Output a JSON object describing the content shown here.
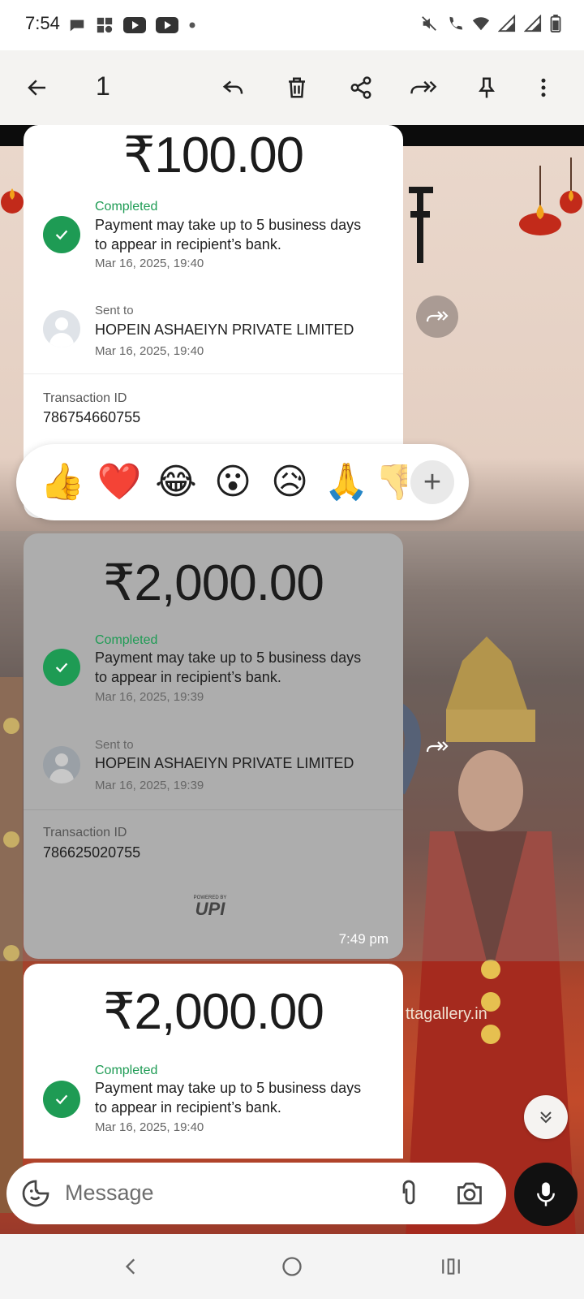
{
  "status_bar": {
    "time": "7:54",
    "left_icons": [
      "chat-bubble-icon",
      "photos-icon",
      "youtube-icon",
      "youtube-icon",
      "dot-icon"
    ],
    "right_icons": [
      "mute-icon",
      "wifi-calling-icon",
      "wifi-icon",
      "signal-icon",
      "signal-icon",
      "battery-icon"
    ]
  },
  "toolbar": {
    "selected_count": "1",
    "actions": [
      "back",
      "reply",
      "delete",
      "share",
      "forward",
      "pin",
      "more"
    ]
  },
  "reactions": {
    "emojis": [
      "👍",
      "❤️",
      "😂",
      "😮",
      "😥",
      "🙏",
      "👎"
    ],
    "add_label": "+"
  },
  "messages": [
    {
      "amount": "₹100.00",
      "status": "Completed",
      "note_line1": "Payment may take up to 5 business days",
      "note_line2": "to appear in recipient’s bank.",
      "payment_time": "Mar 16, 2025, 19:40",
      "sent_to_label": "Sent to",
      "recipient": "HOPEIN ASHAEIYN PRIVATE LIMITED",
      "sent_time": "Mar 16, 2025, 19:40",
      "txn_label": "Transaction ID",
      "txn_id": "786754660755"
    },
    {
      "amount": "₹2,000.00",
      "status": "Completed",
      "note_line1": "Payment may take up to 5 business days",
      "note_line2": "to appear in recipient’s bank.",
      "payment_time": "Mar 16, 2025, 19:39",
      "sent_to_label": "Sent to",
      "recipient": "HOPEIN ASHAEIYN PRIVATE LIMITED",
      "sent_time": "Mar 16, 2025, 19:39",
      "txn_label": "Transaction ID",
      "txn_id": "786625020755",
      "upi_powered": "POWERED BY",
      "upi_logo": "UPI",
      "time": "7:49 pm"
    },
    {
      "amount": "₹2,000.00",
      "status": "Completed",
      "note_line1": "Payment may take up to 5 business days",
      "note_line2": "to appear in recipient’s bank.",
      "payment_time": "Mar 16, 2025, 19:40"
    }
  ],
  "wallpaper_watermark": "ttagallery.in",
  "composer": {
    "placeholder": "Message"
  },
  "colors": {
    "status_green": "#1e9b54",
    "selected_card": "#adadad",
    "toolbar_bg": "#f4f3f1"
  }
}
